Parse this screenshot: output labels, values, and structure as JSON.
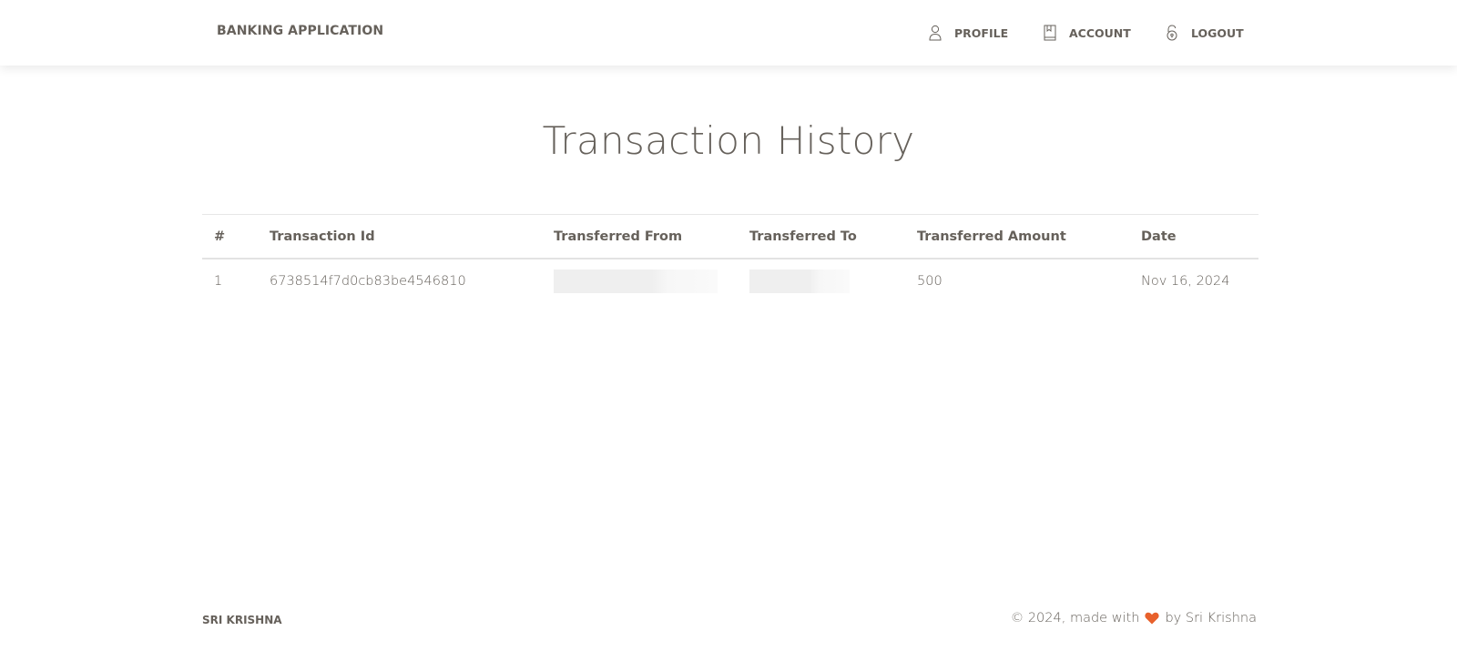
{
  "navbar": {
    "brand": "BANKING APPLICATION",
    "items": [
      {
        "label": "PROFILE",
        "icon": "user-icon"
      },
      {
        "label": "ACCOUNT",
        "icon": "bookmark-book-icon"
      },
      {
        "label": "LOGOUT",
        "icon": "unlock-icon"
      }
    ]
  },
  "page": {
    "title": "Transaction History"
  },
  "table": {
    "headers": [
      "#",
      "Transaction Id",
      "Transferred From",
      "Transferred To",
      "Transferred Amount",
      "Date"
    ],
    "rows": [
      {
        "num": "1",
        "transaction_id": "6738514f7d0cb83be4546810",
        "transferred_from": "",
        "transferred_to": "",
        "amount": "500",
        "date": "Nov 16, 2024"
      }
    ]
  },
  "footer": {
    "left": "SRI KRISHNA",
    "right_prefix": "© 2024, made with",
    "right_suffix": "by Sri Krishna",
    "heart_color": "#e8612c"
  },
  "colors": {
    "text": "#66615b",
    "accent": "#e8612c"
  }
}
